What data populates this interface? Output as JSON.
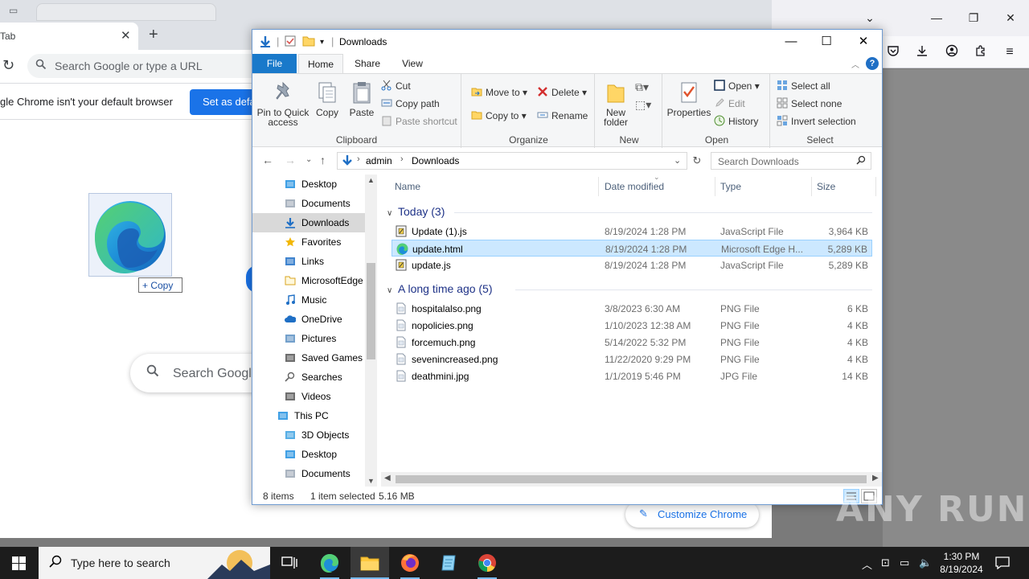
{
  "firefox": {
    "toolbar_icons": [
      "pocket-icon",
      "downloads-icon",
      "account-icon",
      "extensions-icon",
      "menu-icon"
    ]
  },
  "chrome": {
    "tab_title": "Tab",
    "omnibox_placeholder": "Search Google or type a URL",
    "infobar_text": "gle Chrome isn't your default browser",
    "infobar_button": "Set as defau",
    "search_placeholder": "Search Google",
    "customize_label": "Customize Chrome",
    "drag_copy_label": "+ Copy"
  },
  "explorer": {
    "title": "Downloads",
    "tabs": {
      "file": "File",
      "home": "Home",
      "share": "Share",
      "view": "View"
    },
    "ribbon": {
      "clipboard": {
        "label": "Clipboard",
        "pin": "Pin to Quick access",
        "copy": "Copy",
        "paste": "Paste",
        "cut": "Cut",
        "copy_path": "Copy path",
        "paste_shortcut": "Paste shortcut"
      },
      "organize": {
        "label": "Organize",
        "move_to": "Move to",
        "copy_to": "Copy to",
        "delete": "Delete",
        "rename": "Rename"
      },
      "new": {
        "label": "New",
        "new_folder": "New folder"
      },
      "open": {
        "label": "Open",
        "properties": "Properties",
        "open": "Open",
        "edit": "Edit",
        "history": "History"
      },
      "select": {
        "label": "Select",
        "select_all": "Select all",
        "select_none": "Select none",
        "invert": "Invert selection"
      }
    },
    "address": {
      "crumbs": [
        "admin",
        "Downloads"
      ]
    },
    "search_placeholder": "Search Downloads",
    "nav_items": [
      {
        "label": "Desktop",
        "icon": "desktop-icon"
      },
      {
        "label": "Documents",
        "icon": "documents-icon"
      },
      {
        "label": "Downloads",
        "icon": "downloads-icon",
        "selected": true
      },
      {
        "label": "Favorites",
        "icon": "star-icon"
      },
      {
        "label": "Links",
        "icon": "links-icon"
      },
      {
        "label": "MicrosoftEdge",
        "icon": "folder-icon"
      },
      {
        "label": "Music",
        "icon": "music-icon"
      },
      {
        "label": "OneDrive",
        "icon": "onedrive-icon"
      },
      {
        "label": "Pictures",
        "icon": "pictures-icon"
      },
      {
        "label": "Saved Games",
        "icon": "saved-games-icon"
      },
      {
        "label": "Searches",
        "icon": "searches-icon"
      },
      {
        "label": "Videos",
        "icon": "videos-icon"
      },
      {
        "label": "This PC",
        "icon": "this-pc-icon"
      },
      {
        "label": "3D Objects",
        "icon": "3d-objects-icon"
      },
      {
        "label": "Desktop",
        "icon": "desktop-icon"
      },
      {
        "label": "Documents",
        "icon": "documents-icon"
      }
    ],
    "columns": {
      "name": "Name",
      "date": "Date modified",
      "type": "Type",
      "size": "Size"
    },
    "groups": [
      {
        "title": "Today (3)",
        "files": [
          {
            "name": "Update (1).js",
            "date": "8/19/2024 1:28 PM",
            "type": "JavaScript File",
            "size": "3,964 KB",
            "icon": "js-file-icon"
          },
          {
            "name": "update.html",
            "date": "8/19/2024 1:28 PM",
            "type": "Microsoft Edge H...",
            "size": "5,289 KB",
            "icon": "edge-html-icon",
            "selected": true
          },
          {
            "name": "update.js",
            "date": "8/19/2024 1:28 PM",
            "type": "JavaScript File",
            "size": "5,289 KB",
            "icon": "js-file-icon"
          }
        ]
      },
      {
        "title": "A long time ago (5)",
        "files": [
          {
            "name": "hospitalalso.png",
            "date": "3/8/2023 6:30 AM",
            "type": "PNG File",
            "size": "6 KB",
            "icon": "image-file-icon"
          },
          {
            "name": "nopolicies.png",
            "date": "1/10/2023 12:38 AM",
            "type": "PNG File",
            "size": "4 KB",
            "icon": "image-file-icon"
          },
          {
            "name": "forcemuch.png",
            "date": "5/14/2022 5:32 PM",
            "type": "PNG File",
            "size": "4 KB",
            "icon": "image-file-icon"
          },
          {
            "name": "sevenincreased.png",
            "date": "11/22/2020 9:29 PM",
            "type": "PNG File",
            "size": "4 KB",
            "icon": "image-file-icon"
          },
          {
            "name": "deathmini.jpg",
            "date": "1/1/2019 5:46 PM",
            "type": "JPG File",
            "size": "14 KB",
            "icon": "image-file-icon"
          }
        ]
      }
    ],
    "status": {
      "items": "8 items",
      "selected": "1 item selected",
      "size": "5.16 MB"
    }
  },
  "watermark": "ANY RUN",
  "taskbar": {
    "search_placeholder": "Type here to search",
    "time": "1:30 PM",
    "date": "8/19/2024"
  }
}
